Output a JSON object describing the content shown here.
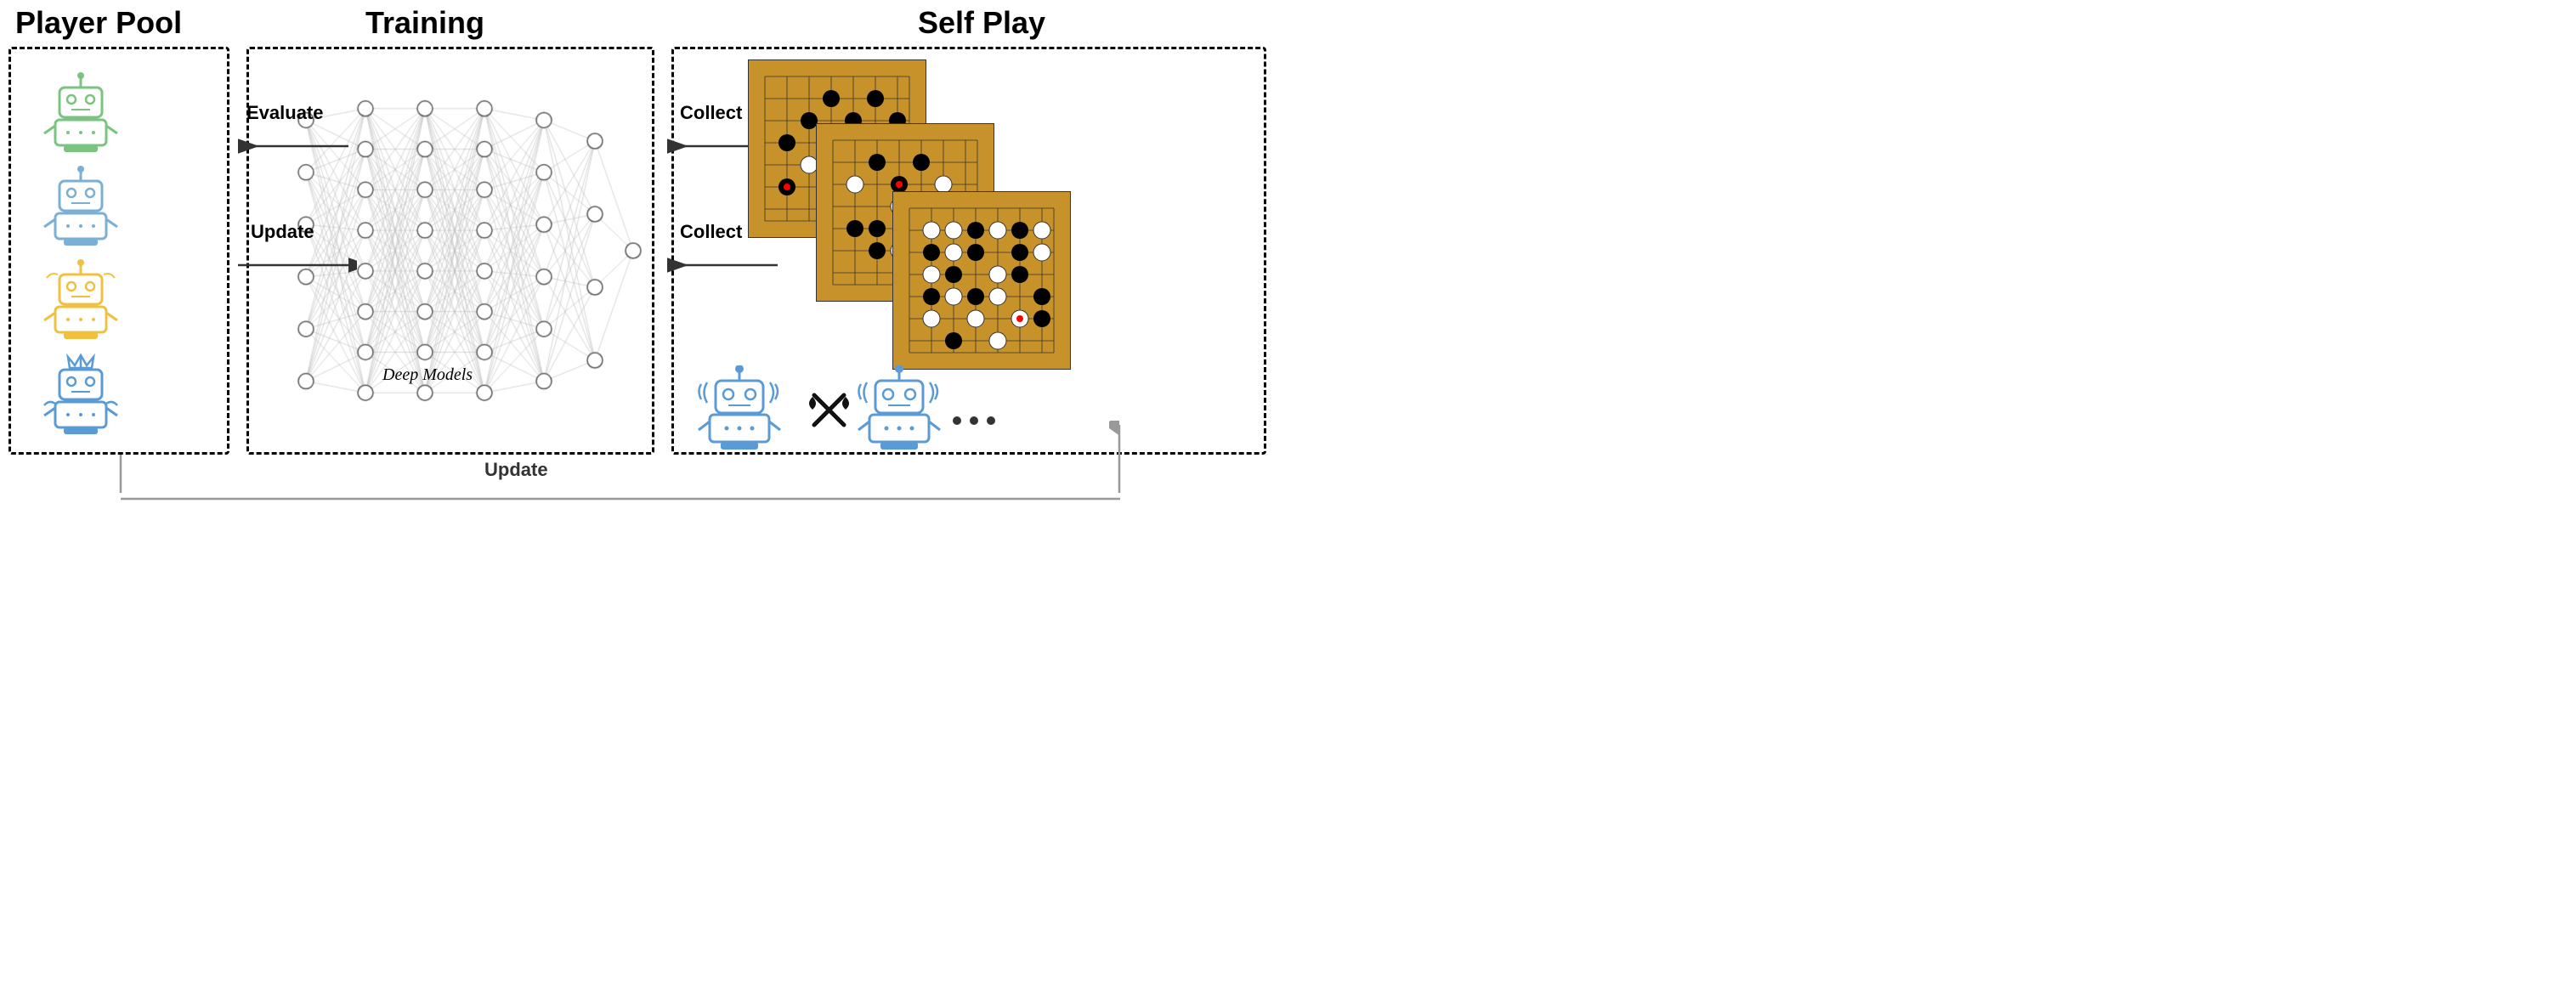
{
  "titles": {
    "player_pool": "Player Pool",
    "training": "Training",
    "self_play": "Self Play"
  },
  "labels": {
    "evaluate": "Evaluate",
    "update_training": "Update",
    "collect_top": "Collect",
    "collect_bottom": "Collect",
    "update_bottom": "Update",
    "deep_models": "Deep Models"
  },
  "colors": {
    "green_robot": "#7bc47f",
    "blue_robot": "#7bafd4",
    "yellow_robot": "#f0c040",
    "blue_champion": "#5b9bd5",
    "board_color": "#c8922a",
    "line_color": "#333"
  }
}
